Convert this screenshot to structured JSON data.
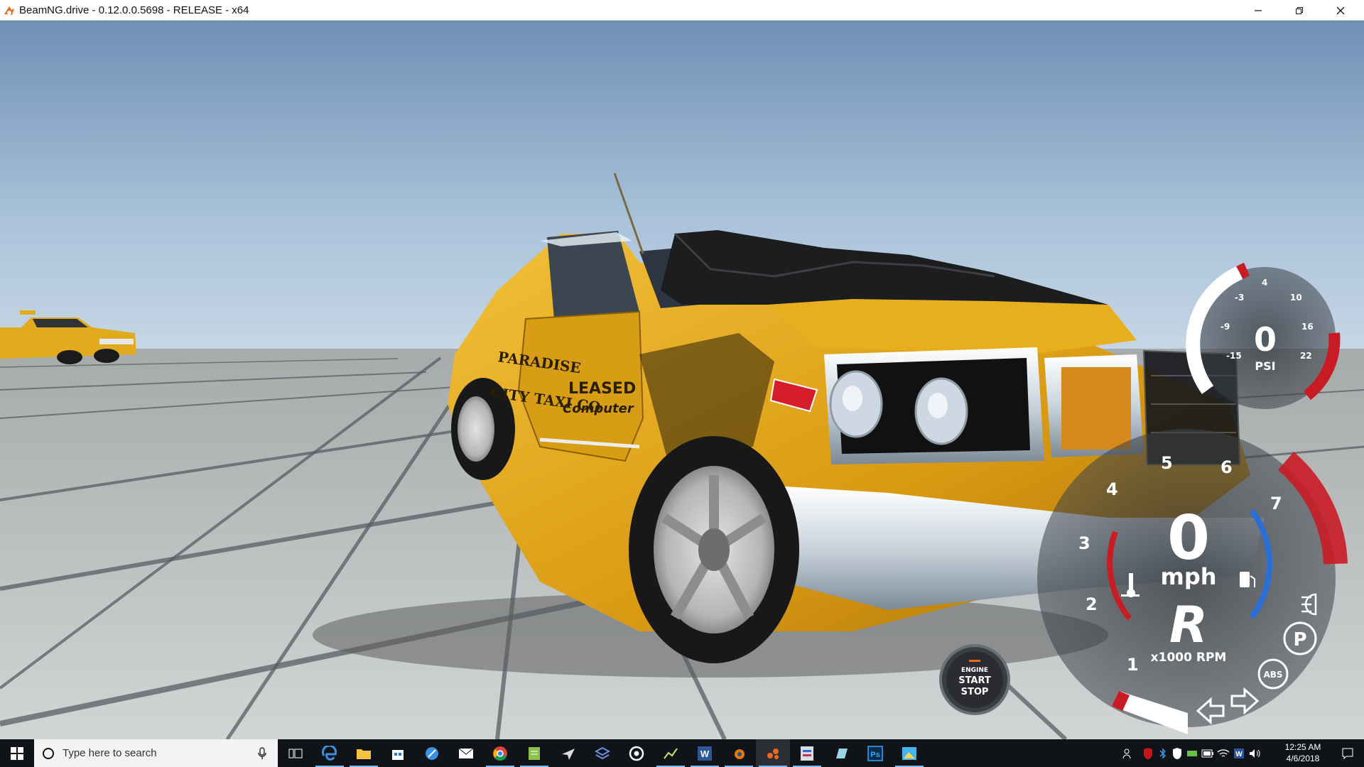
{
  "window": {
    "title": "BeamNG.drive - 0.12.0.0.5698 - RELEASE - x64",
    "controls": [
      "minimize",
      "restore",
      "close"
    ]
  },
  "hud": {
    "boost_gauge": {
      "value": "0",
      "unit": "PSI",
      "tick_labels": [
        "-15",
        "-9",
        "-3",
        "4",
        "10",
        "16",
        "22"
      ]
    },
    "speedometer": {
      "speed": "0",
      "speed_unit": "mph",
      "gear": "R",
      "rpm_unit": "x1000 RPM",
      "rpm_labels": [
        "1",
        "2",
        "3",
        "4",
        "5",
        "6",
        "7"
      ],
      "rpm_fraction": 0.0
    },
    "engine_button": {
      "line1": "ENGINE",
      "line2": "START",
      "line3": "STOP"
    },
    "indicators": {
      "parking": "P",
      "abs": "ABS",
      "temp_icon": "thermometer-icon",
      "fuel_icon": "fuel-pump-icon",
      "lights_icon": "headlight-icon",
      "left_signal": "arrow-left-icon",
      "right_signal": "arrow-right-icon"
    }
  },
  "scene": {
    "car_text": [
      "LEASED",
      "Computer",
      "CITY TAXI CO",
      "PARADISE"
    ]
  },
  "taskbar": {
    "search_placeholder": "Type here to search",
    "apps": [
      "start-icon",
      "task-view-icon",
      "edge-icon",
      "file-explorer-icon",
      "store-icon",
      "browser-icon",
      "mail-icon",
      "chrome-icon",
      "notepad-icon",
      "plane-icon",
      "layers-icon",
      "steam-icon",
      "graph-icon",
      "word-icon",
      "blender-icon",
      "beamng-icon",
      "app-icon",
      "paper-icon",
      "photoshop-icon",
      "image-icon"
    ],
    "clock_time": "12:25 AM",
    "clock_date": "4/6/2018"
  },
  "colors": {
    "sky_top": "#6f8fb4",
    "sky_bottom": "#b7cde0",
    "taxi_yellow": "#e9ad1c",
    "hud_red": "#c91b24",
    "hud_blue": "#2a6fd6",
    "taskbar": "#101418"
  }
}
